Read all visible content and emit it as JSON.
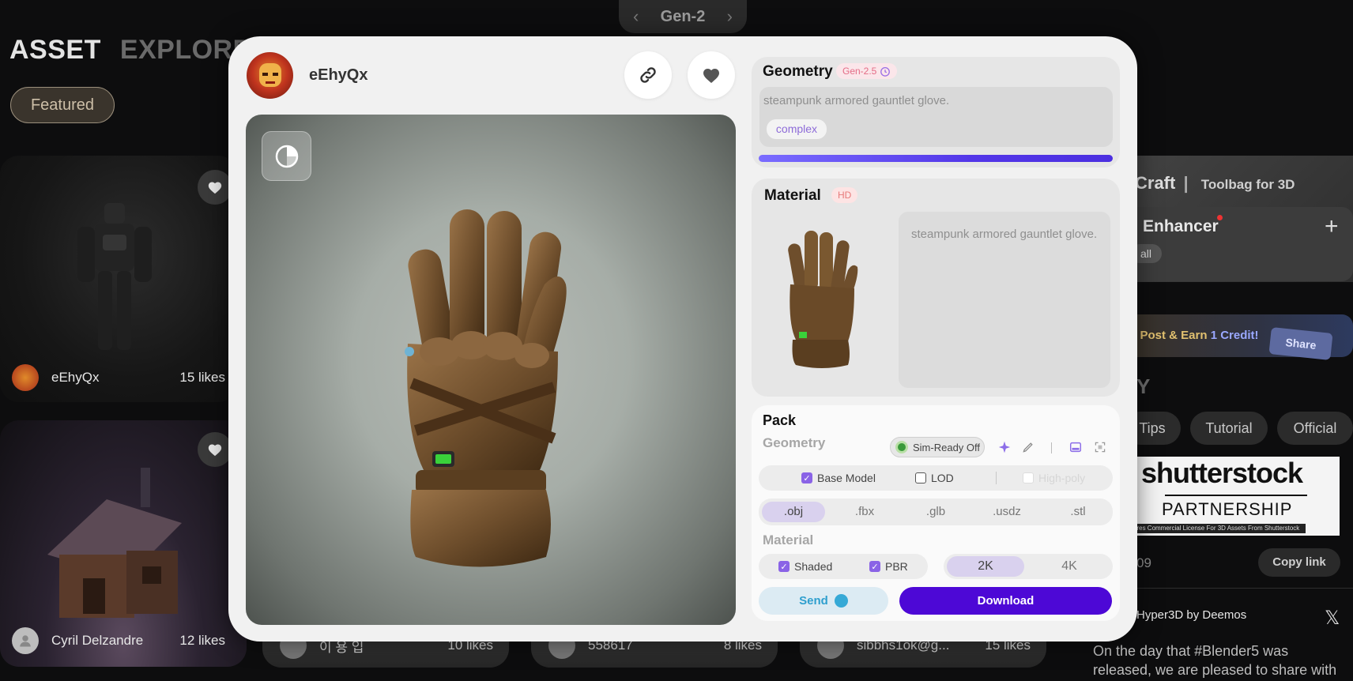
{
  "background": {
    "gen_selector": {
      "label": "Gen-2",
      "prev": "‹",
      "next": "›"
    },
    "title": {
      "asset": "ASSET",
      "explore": "EXPLORE"
    },
    "filter_chip": "Featured",
    "cards": [
      {
        "user": "eEhyQx",
        "likes": "15 likes"
      },
      {
        "user": "Cyril Delzandre",
        "likes": "12 likes"
      }
    ],
    "bottom_cards": [
      {
        "user": "이 용 입",
        "likes": "10 likes"
      },
      {
        "user": "558617",
        "likes": "8 likes"
      },
      {
        "user": "sibbhs1ok@g...",
        "likes": "15 likes"
      }
    ],
    "right": {
      "promo_title": "Craft",
      "promo_sub": "Toolbag for 3D",
      "enhancer_title": "Enhancer",
      "enhancer_all": "all",
      "enhancer_plus": "+",
      "share_text": "a Post & Earn",
      "share_credit": "1 Credit!",
      "share_button": "Share",
      "section_letter": "Y",
      "tabs": [
        "Tips",
        "Tutorial",
        "Official"
      ],
      "shutter_word": "shutterstock",
      "partnership": "PARTNERSHIP",
      "shutter_caption": "ures Commercial License For 3D Assets From Shutterstock",
      "date_fragment": "09",
      "copy_link": "Copy link",
      "post_author": "Hyper3D by Deemos",
      "post_text": "On the day that #Blender5 was released, we are pleased to share with"
    }
  },
  "modal": {
    "username": "eEhyQx",
    "geometry": {
      "title": "Geometry",
      "badge": "Gen-2.5",
      "prompt": "steampunk armored gauntlet glove.",
      "tag": "complex",
      "progress": 1.0
    },
    "material": {
      "title": "Material",
      "badge": "HD",
      "description": "steampunk armored gauntlet glove."
    },
    "pack": {
      "title": "Pack",
      "geometry_label": "Geometry",
      "sim_ready": "Sim-Ready Off",
      "base_model": "Base Model",
      "lod": "LOD",
      "high_poly": "High-poly",
      "formats": [
        ".obj",
        ".fbx",
        ".glb",
        ".usdz",
        ".stl"
      ],
      "selected_format": ".obj",
      "material_label": "Material",
      "shaded": "Shaded",
      "pbr": "PBR",
      "resolutions": [
        "2K",
        "4K"
      ],
      "selected_resolution": "2K",
      "send": "Send",
      "download": "Download"
    }
  }
}
